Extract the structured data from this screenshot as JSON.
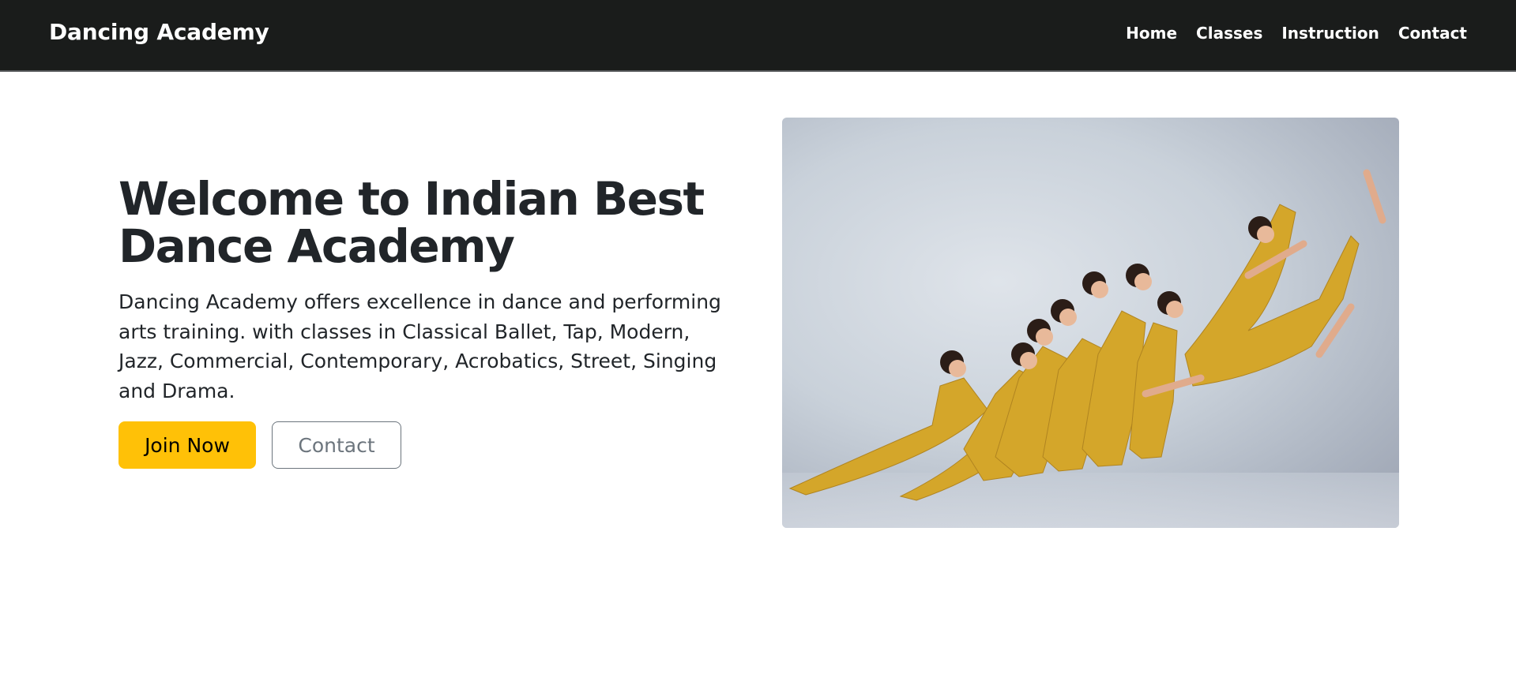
{
  "navbar": {
    "brand": "Dancing Academy",
    "links": [
      "Home",
      "Classes",
      "Instruction",
      "Contact"
    ]
  },
  "hero": {
    "title_line1": "Welcome to Indian Best",
    "title_line2": "Dance Academy",
    "description": "Dancing Academy offers excellence in dance and performing arts training. with classes in Classical Ballet, Tap, Modern, Jazz, Commercial, Contemporary, Acrobatics, Street, Singing and Drama.",
    "primary_button": "Join Now",
    "secondary_button": "Contact"
  },
  "colors": {
    "navbar_bg": "#1a1c1b",
    "primary_button": "#ffc107",
    "outline_button": "#6c757d",
    "costume": "#d4a62a"
  }
}
